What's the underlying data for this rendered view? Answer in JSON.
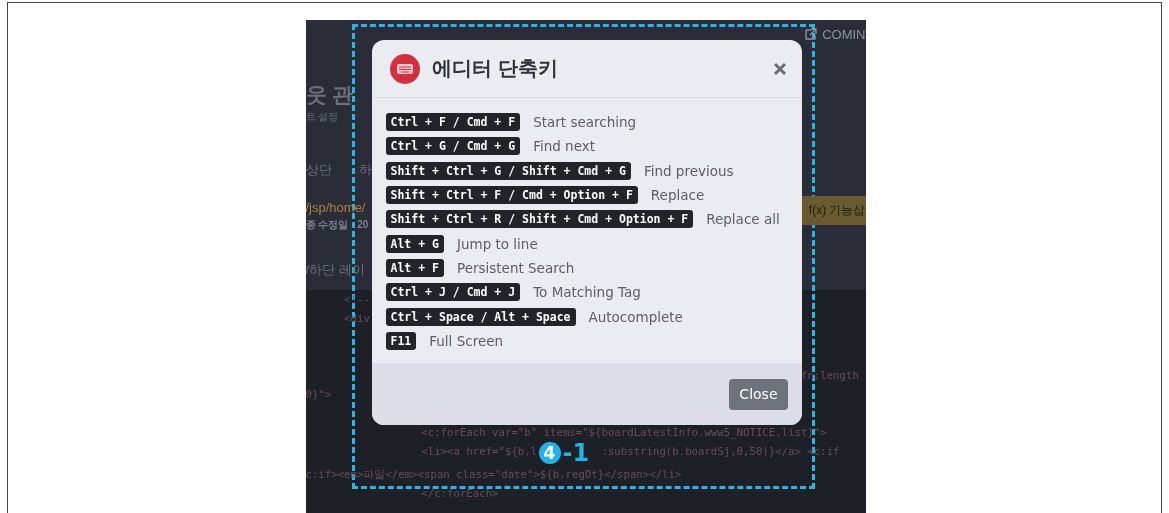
{
  "background_page": {
    "header_link": "COMIN",
    "title": "웃 관",
    "subtitle": "트 설정",
    "tabs": [
      {
        "label": "상단"
      },
      {
        "label": "하"
      }
    ],
    "path": "/jsp/home/",
    "modified": "종 수정일 : 20",
    "function_button": "f(x) 기능삽",
    "section_label": "/하단 레이",
    "code_lines": [
      {
        "parts": [
          "      <!--"
        ]
      },
      {
        "parts": [
          "      <div"
        ]
      },
      {
        "parts": [
          "                                                                             fn:length"
        ]
      },
      {
        "parts": [
          "0}\">"
        ]
      },
      {
        "parts": [
          "                  <c:forEach var=\"b\" items=\"${boardLatestInfo.www5_NOTICE.list}\">"
        ]
      },
      {
        "parts": [
          "                  <li><a href=\"${b.l",
          ":substring(b.boardSj,0,50)}</a> <c:if"
        ]
      },
      {
        "parts": [
          "c:if><em>파일</em><span class=\"date\">${b.regDt}</span></li>"
        ]
      },
      {
        "parts": [
          "                  </c:forEach>"
        ]
      }
    ]
  },
  "dialog": {
    "title": "에디터 단축키",
    "shortcuts": [
      {
        "keys": "Ctrl + F / Cmd + F",
        "action": "Start searching"
      },
      {
        "keys": "Ctrl + G / Cmd + G",
        "action": "Find next"
      },
      {
        "keys": "Shift + Ctrl + G / Shift + Cmd + G",
        "action": "Find previous"
      },
      {
        "keys": "Shift + Ctrl + F / Cmd + Option + F",
        "action": "Replace"
      },
      {
        "keys": "Shift + Ctrl + R / Shift + Cmd + Option + F",
        "action": "Replace all"
      },
      {
        "keys": "Alt + G",
        "action": "Jump to line"
      },
      {
        "keys": "Alt + F",
        "action": "Persistent Search"
      },
      {
        "keys": "Ctrl + J / Cmd + J",
        "action": "To Matching Tag"
      },
      {
        "keys": "Ctrl + Space / Alt + Space",
        "action": "Autocomplete"
      },
      {
        "keys": "F11",
        "action": "Full Screen"
      }
    ],
    "close_button": "Close"
  },
  "annotation": {
    "step_number": "4",
    "step_suffix": "-1"
  }
}
